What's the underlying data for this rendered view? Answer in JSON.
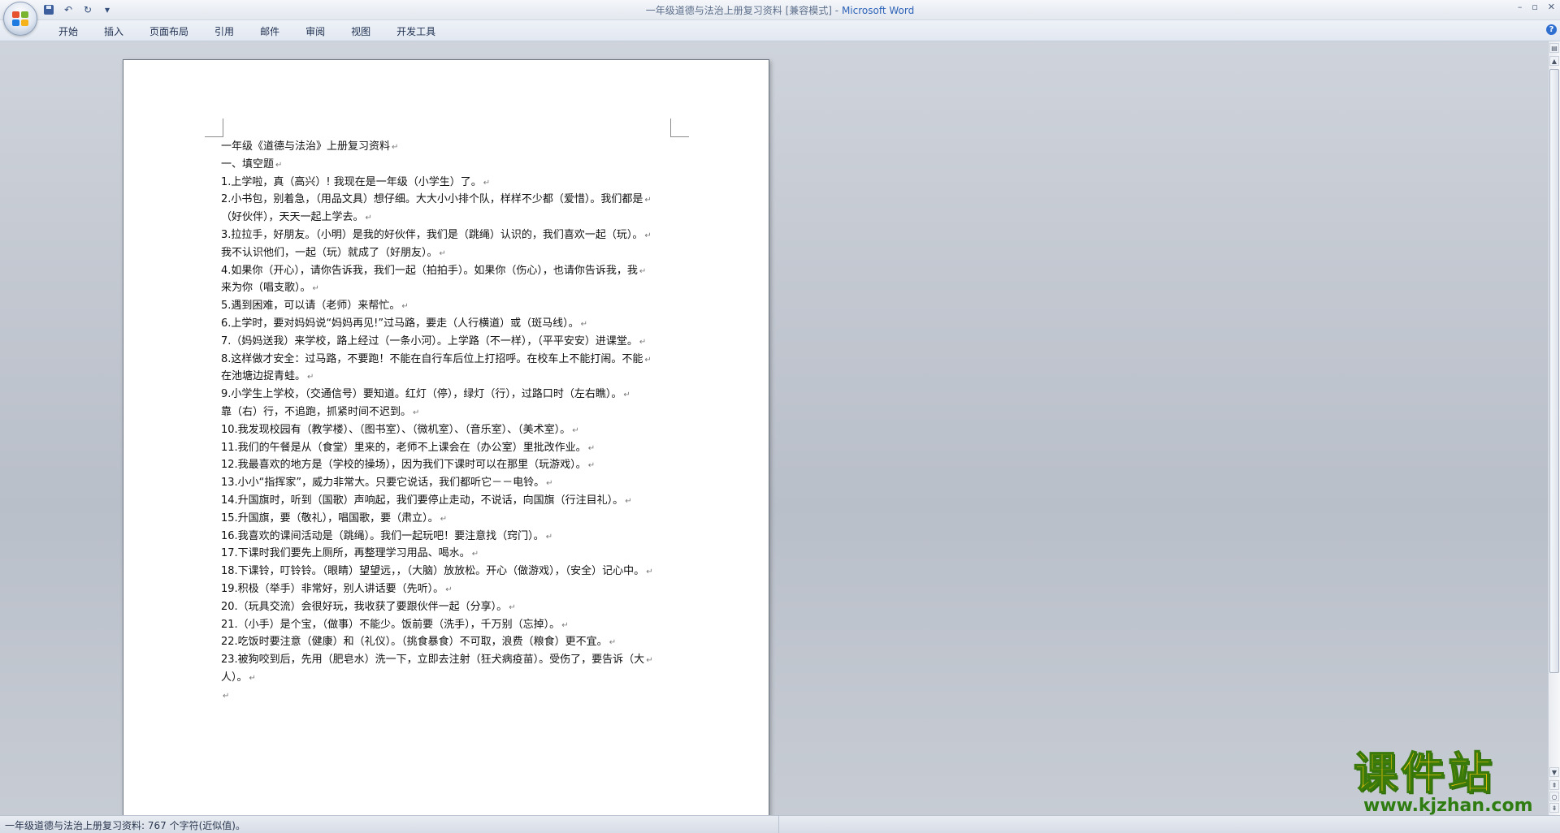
{
  "window": {
    "doc_title": "一年级道德与法治上册复习资料 [兼容模式]",
    "separator": " - ",
    "app_name": "Microsoft Word"
  },
  "ribbon": {
    "tabs": [
      "开始",
      "插入",
      "页面布局",
      "引用",
      "邮件",
      "审阅",
      "视图",
      "开发工具"
    ]
  },
  "document": {
    "lines": [
      "一年级《道德与法治》上册复习资料",
      "一、填空题",
      "1.上学啦，真（高兴）! 我现在是一年级（小学生）了。",
      "2.小书包，别着急，（用品文具）想仔细。大大小小排个队，样样不少都（爱惜）。我们都是",
      "（好伙伴），天天一起上学去。",
      "3.拉拉手，好朋友。（小明）是我的好伙伴，我们是（跳绳）认识的，我们喜欢一起（玩）。",
      "我不认识他们，一起（玩）就成了（好朋友）。",
      "4.如果你（开心），请你告诉我，我们一起（拍拍手）。如果你（伤心），也请你告诉我，我",
      "来为你（唱支歌）。",
      "5.遇到困难，可以请（老师）来帮忙。",
      "6.上学时，要对妈妈说“妈妈再见!”过马路，要走（人行横道）或（斑马线）。",
      "7.（妈妈送我）来学校，路上经过（一条小河）。上学路（不一样），（平平安安）进课堂。",
      "8.这样做才安全：过马路，不要跑！不能在自行车后位上打招呼。在校车上不能打闹。不能",
      "在池塘边捉青蛙。",
      "9.小学生上学校，（交通信号）要知道。红灯（停），绿灯（行），过路口时（左右瞧）。",
      "靠（右）行，不追跑，抓紧时间不迟到。",
      "10.我发现校园有（教学楼）、（图书室）、（微机室）、（音乐室）、（美术室）。",
      "11.我们的午餐是从（食堂）里来的，老师不上课会在（办公室）里批改作业。",
      "12.我最喜欢的地方是（学校的操场），因为我们下课时可以在那里（玩游戏）。",
      "13.小小“指挥家”，威力非常大。只要它说话，我们都听它－－电铃。",
      "14.升国旗时，听到（国歌）声响起，我们要停止走动，不说话，向国旗（行注目礼）。",
      "15.升国旗，要（敬礼），唱国歌，要（肃立）。",
      "16.我喜欢的课间活动是（跳绳）。我们一起玩吧！要注意找（窍门）。",
      "17.下课时我们要先上厕所，再整理学习用品、喝水。",
      "18.下课铃，叮铃铃。（眼睛）望望远，，（大脑）放放松。开心（做游戏），（安全）记心中。",
      "19.积极（举手）非常好，别人讲话要（先听）。",
      "20.（玩具交流）会很好玩，我收获了要跟伙伴一起（分享）。",
      "21.（小手）是个宝，（做事）不能少。饭前要（洗手），千万别（忘掉）。",
      "22.吃饭时要注意（健康）和（礼仪）。（挑食暴食）不可取，浪费（粮食）更不宜。",
      "23.被狗咬到后，先用（肥皂水）洗一下，立即去注射（狂犬病疫苗）。受伤了，要告诉（大",
      "人）。",
      ""
    ]
  },
  "status": {
    "text": "一年级道德与法治上册复习资料: 767 个字符(近似值)。"
  },
  "watermark": {
    "cn": "课件站",
    "url": "www.kjzhan.com"
  },
  "colors": {
    "app_name": "#2e63b8",
    "logo": [
      "#e8532f",
      "#7ab530",
      "#1f7be0",
      "#f6b21a"
    ]
  }
}
